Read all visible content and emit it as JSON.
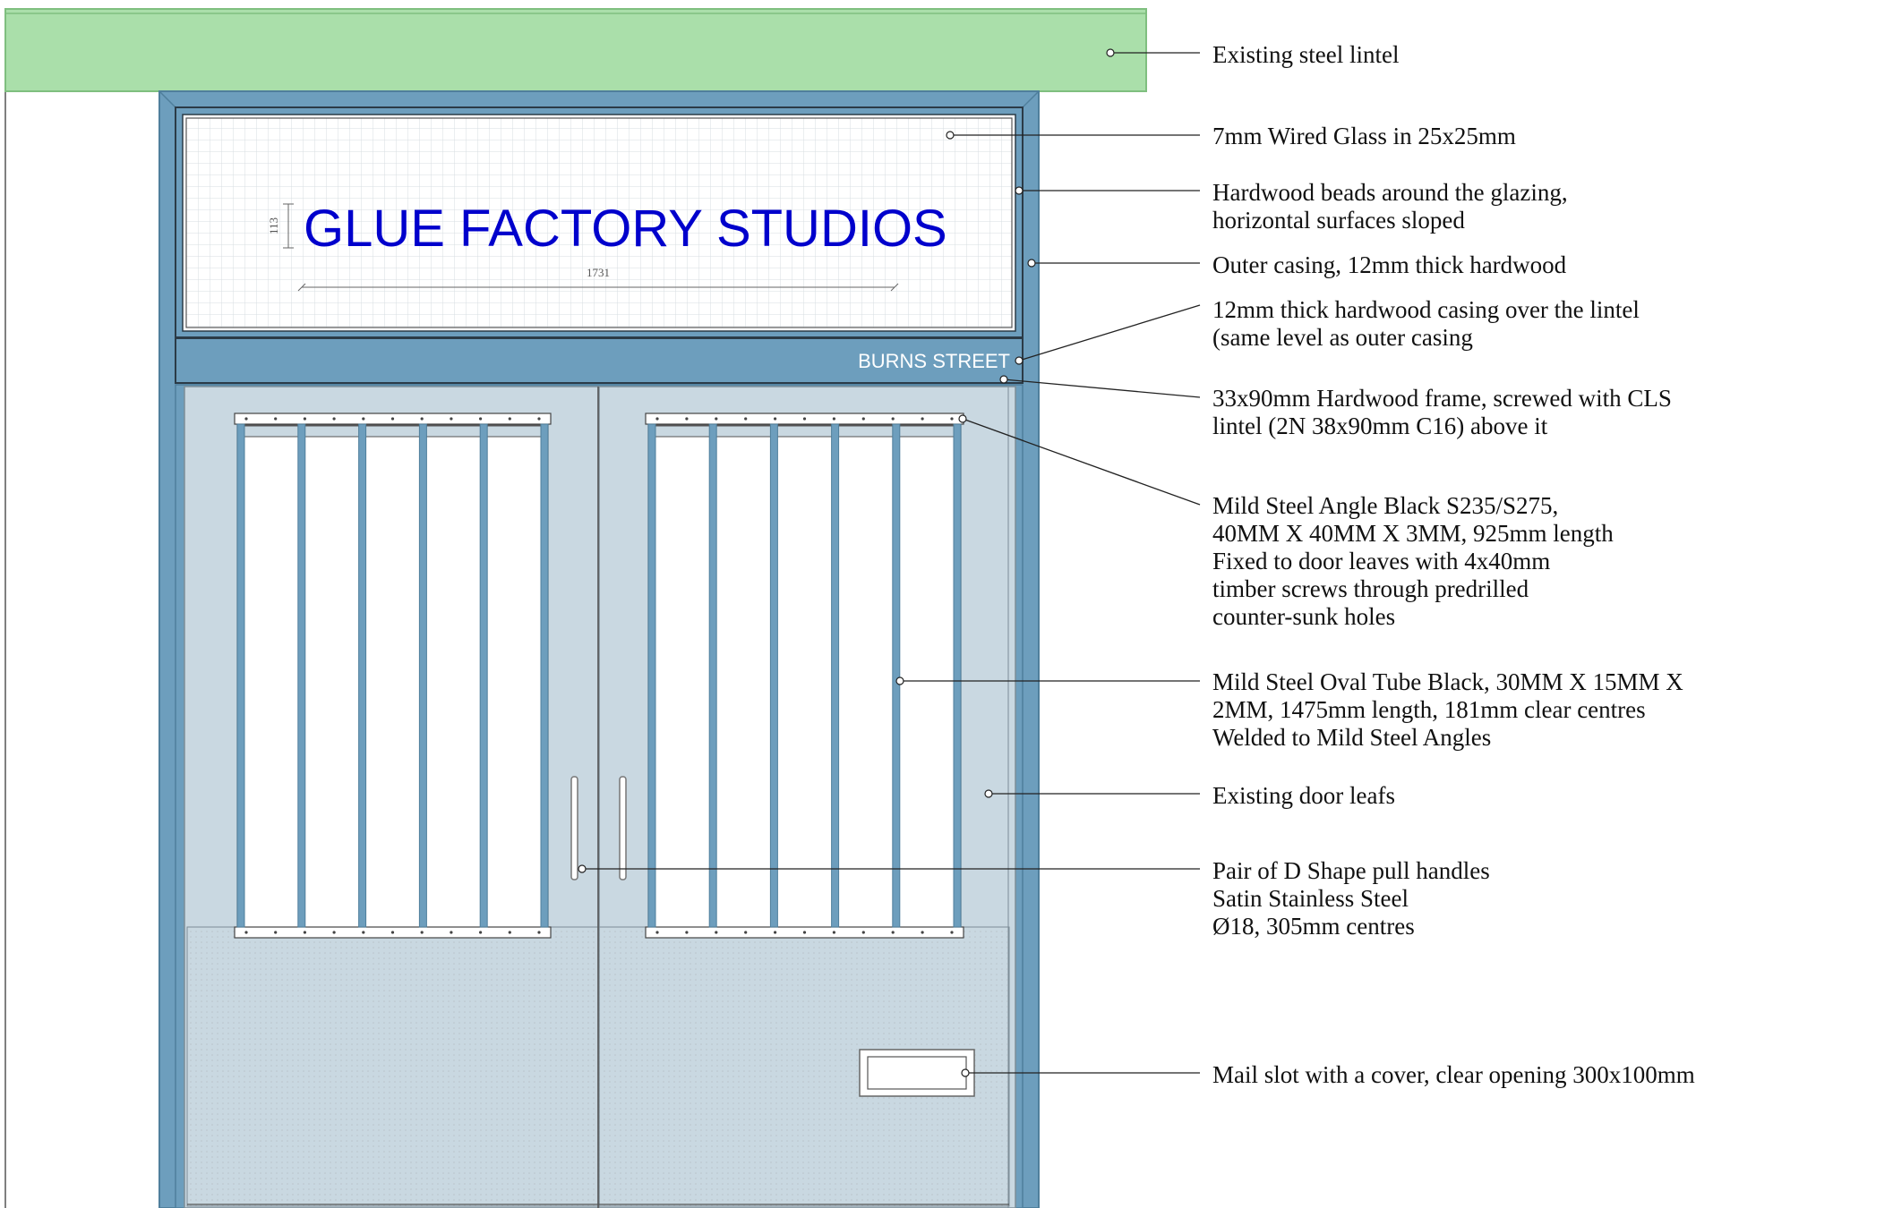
{
  "sign": {
    "title": "GLUE FACTORY STUDIOS",
    "street": "BURNS STREET"
  },
  "dimensions": {
    "text_width": "1731",
    "text_height": "113"
  },
  "colors": {
    "lintel": "#aadfaa",
    "lintel_edge": "#7fbf7f",
    "casing": "#6d9ebd",
    "casing_dark": "#4f7f9c",
    "door": "#c9d8e1",
    "sign_text": "#0000cc",
    "street_text": "#ffffff",
    "grid": "#d9dee3",
    "leader": "#222222"
  },
  "annotations": [
    {
      "id": "lintel",
      "lines": [
        "Existing steel lintel"
      ]
    },
    {
      "id": "wired-glass",
      "lines": [
        "7mm Wired Glass in 25x25mm"
      ]
    },
    {
      "id": "hardwood-beads",
      "lines": [
        "Hardwood beads around the glazing,",
        "horizontal surfaces sloped"
      ]
    },
    {
      "id": "outer-casing",
      "lines": [
        "Outer casing, 12mm thick hardwood"
      ]
    },
    {
      "id": "lintel-casing",
      "lines": [
        "12mm thick hardwood casing over the lintel",
        "(same level as outer casing"
      ]
    },
    {
      "id": "hardwood-frame",
      "lines": [
        "33x90mm Hardwood frame, screwed with CLS",
        "lintel (2N 38x90mm C16) above it"
      ]
    },
    {
      "id": "steel-angle",
      "lines": [
        "Mild Steel Angle Black S235/S275,",
        "40MM X 40MM X 3MM, 925mm length",
        "Fixed to door leaves with 4x40mm",
        "timber screws through predrilled",
        "counter-sunk holes"
      ]
    },
    {
      "id": "oval-tube",
      "lines": [
        "Mild Steel Oval Tube Black, 30MM X 15MM X",
        "2MM, 1475mm length, 181mm clear centres",
        "Welded to Mild Steel Angles"
      ]
    },
    {
      "id": "door-leafs",
      "lines": [
        "Existing door leafs"
      ]
    },
    {
      "id": "pull-handles",
      "lines": [
        "Pair of D Shape pull handles",
        "Satin Stainless Steel",
        "Ø18, 305mm centres"
      ]
    },
    {
      "id": "mail-slot",
      "lines": [
        "Mail slot with a cover, clear opening 300x100mm"
      ]
    }
  ]
}
